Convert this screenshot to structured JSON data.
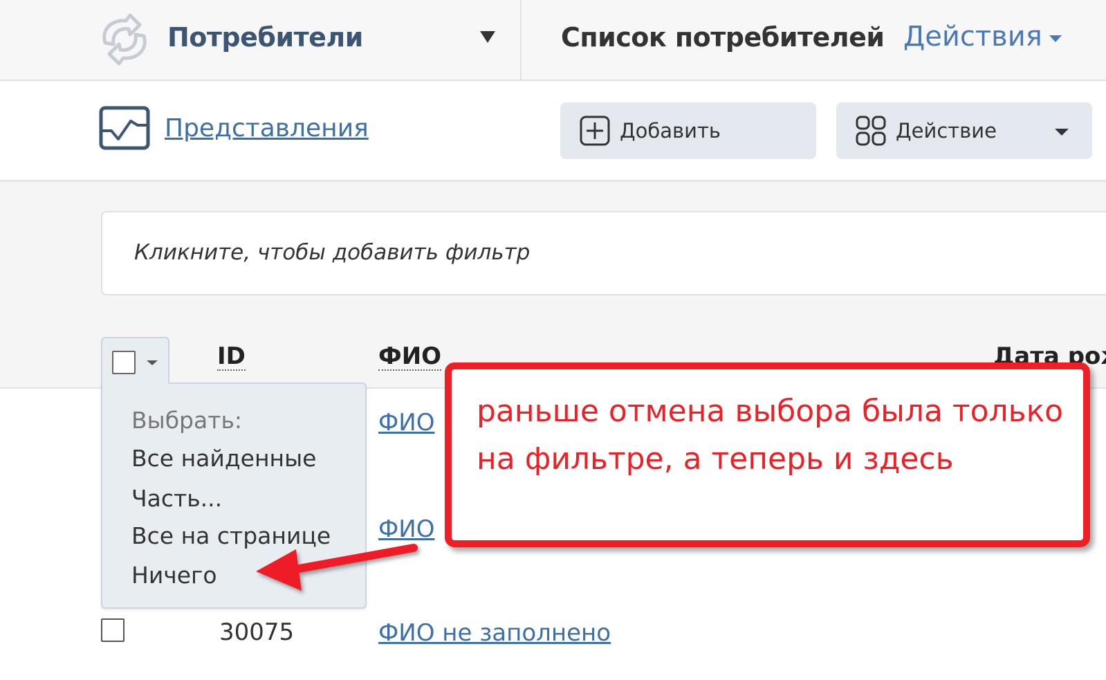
{
  "header": {
    "module_title": "Потребители",
    "page_title": "Список потребителей",
    "actions_label": "Действия"
  },
  "toolbar": {
    "views_label": "Представления",
    "add_label": "Добавить",
    "action_label": "Действие"
  },
  "filter": {
    "placeholder": "Кликните, чтобы добавить фильтр"
  },
  "table": {
    "columns": [
      "ID",
      "ФИО",
      "Дата рож"
    ],
    "rows": [
      {
        "id": "",
        "fio": "ФИО"
      },
      {
        "id": "",
        "fio": "ФИО"
      },
      {
        "id": "30075",
        "fio": "ФИО не заполнено"
      }
    ]
  },
  "select_menu": {
    "heading": "Выбрать:",
    "items": [
      "Все найденные",
      "Часть...",
      "Все на странице",
      "Ничего"
    ]
  },
  "annotation": {
    "text": "раньше отмена выбора была только на фильтре, а теперь и здесь",
    "color": "#ee1f25"
  },
  "colors": {
    "link": "#3d6fa8",
    "button_bg": "#e3e9ef",
    "accent": "#4a7ab3"
  }
}
